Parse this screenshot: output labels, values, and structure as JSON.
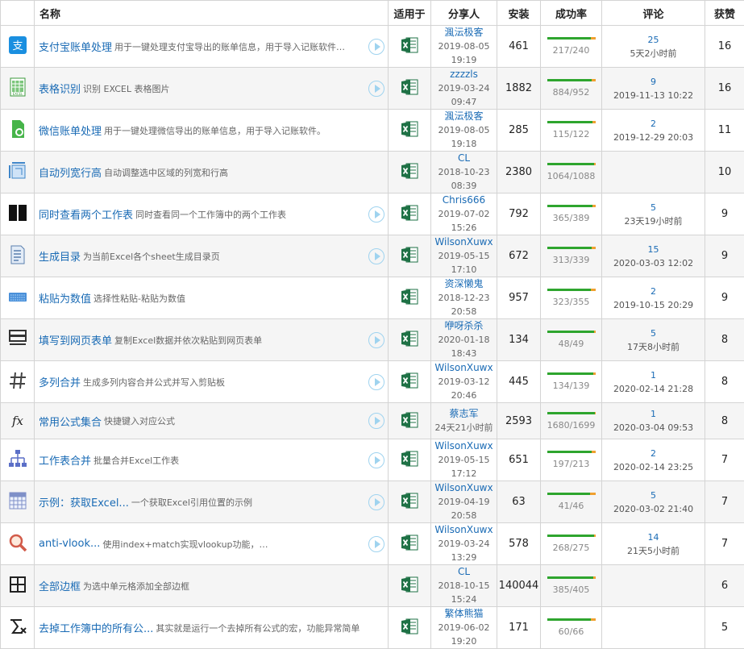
{
  "headers": {
    "icon": "",
    "name": "名称",
    "app": "适用于",
    "sharer": "分享人",
    "installs": "安装",
    "success_rate": "成功率",
    "comments": "评论",
    "likes": "获赞"
  },
  "colors": {
    "link": "#1a6bb5",
    "bar_success": "#2ea52e",
    "bar_fail": "#f0a030",
    "excel_green": "#1e7145"
  },
  "rows": [
    {
      "icon": "alipay-icon",
      "title": "支付宝账单处理",
      "desc": "用于一键处理支付宝导出的账单信息，用于导入记账软件…",
      "play": true,
      "app": "excel-icon",
      "sharer": "渢沄极客",
      "date": "2019-08-05 19:19",
      "installs": "461",
      "success": 217,
      "total": 240,
      "ratio": "217/240",
      "comment_count": "25",
      "comment_time": "5天2小时前",
      "likes": "16"
    },
    {
      "icon": "excel-sheet-icon",
      "title": "表格识别",
      "desc": "识别 EXCEL 表格图片",
      "play": true,
      "app": "excel-icon",
      "sharer": "zzzzls",
      "date": "2019-03-24 09:47",
      "installs": "1882",
      "success": 884,
      "total": 952,
      "ratio": "884/952",
      "comment_count": "9",
      "comment_time": "2019-11-13 10:22",
      "likes": "16"
    },
    {
      "icon": "wechat-bill-icon",
      "title": "微信账单处理",
      "desc": "用于一键处理微信导出的账单信息，用于导入记账软件。",
      "play": false,
      "app": "excel-icon",
      "sharer": "渢沄极客",
      "date": "2019-08-05 19:18",
      "installs": "285",
      "success": 115,
      "total": 122,
      "ratio": "115/122",
      "comment_count": "2",
      "comment_time": "2019-12-29 20:03",
      "likes": "11"
    },
    {
      "icon": "resize-icon",
      "title": "自动列宽行高",
      "desc": "自动调整选中区域的列宽和行高",
      "play": false,
      "app": "excel-icon",
      "sharer": "CL",
      "date": "2018-10-23 08:39",
      "installs": "2380",
      "success": 1064,
      "total": 1088,
      "ratio": "1064/1088",
      "comment_count": "",
      "comment_time": "",
      "likes": "10"
    },
    {
      "icon": "split-view-icon",
      "title": "同时查看两个工作表",
      "desc": "同时查看同一个工作簿中的两个工作表",
      "play": true,
      "app": "excel-icon",
      "sharer": "Chris666",
      "date": "2019-07-02 15:26",
      "installs": "792",
      "success": 365,
      "total": 389,
      "ratio": "365/389",
      "comment_count": "5",
      "comment_time": "23天19小时前",
      "likes": "9"
    },
    {
      "icon": "toc-document-icon",
      "title": "生成目录",
      "desc": "为当前Excel各个sheet生成目录页",
      "play": true,
      "app": "excel-icon",
      "sharer": "WilsonXuwx",
      "date": "2019-05-15 17:10",
      "installs": "672",
      "success": 313,
      "total": 339,
      "ratio": "313/339",
      "comment_count": "15",
      "comment_time": "2020-03-03 12:02",
      "likes": "9"
    },
    {
      "icon": "keyboard-icon",
      "title": "粘贴为数值",
      "desc": "选择性粘贴-粘贴为数值",
      "play": false,
      "app": "excel-icon",
      "sharer": "资深懒鬼",
      "date": "2018-12-23 20:58",
      "installs": "957",
      "success": 323,
      "total": 355,
      "ratio": "323/355",
      "comment_count": "2",
      "comment_time": "2019-10-15 20:29",
      "likes": "9"
    },
    {
      "icon": "web-form-icon",
      "title": "填写到网页表单",
      "desc": "复制Excel数据并依次粘贴到网页表单",
      "play": true,
      "app": "excel-icon",
      "sharer": "咿呀杀杀",
      "date": "2020-01-18 18:43",
      "installs": "134",
      "success": 48,
      "total": 49,
      "ratio": "48/49",
      "comment_count": "5",
      "comment_time": "17天8小时前",
      "likes": "8"
    },
    {
      "icon": "hash-icon",
      "title": "多列合并",
      "desc": "生成多列内容合并公式并写入剪贴板",
      "play": true,
      "app": "excel-icon",
      "sharer": "WilsonXuwx",
      "date": "2019-03-12 20:46",
      "installs": "445",
      "success": 134,
      "total": 139,
      "ratio": "134/139",
      "comment_count": "1",
      "comment_time": "2020-02-14 21:28",
      "likes": "8"
    },
    {
      "icon": "function-icon",
      "title": "常用公式集合",
      "desc": "快捷键入对应公式",
      "play": true,
      "app": "excel-icon",
      "sharer": "蔡志军",
      "date": "24天21小时前",
      "installs": "2593",
      "success": 1680,
      "total": 1699,
      "ratio": "1680/1699",
      "comment_count": "1",
      "comment_time": "2020-03-04 09:53",
      "likes": "8"
    },
    {
      "icon": "org-chart-icon",
      "title": "工作表合并",
      "desc": "批量合并Excel工作表",
      "play": true,
      "app": "excel-icon",
      "sharer": "WilsonXuwx",
      "date": "2019-05-15 17:12",
      "installs": "651",
      "success": 197,
      "total": 213,
      "ratio": "197/213",
      "comment_count": "2",
      "comment_time": "2020-02-14 23:25",
      "likes": "7"
    },
    {
      "icon": "grid-table-icon",
      "title": "示例：获取Excel...",
      "desc": "一个获取Excel引用位置的示例",
      "play": true,
      "app": "excel-icon",
      "sharer": "WilsonXuwx",
      "date": "2019-04-19 20:58",
      "installs": "63",
      "success": 41,
      "total": 46,
      "ratio": "41/46",
      "comment_count": "5",
      "comment_time": "2020-03-02 21:40",
      "likes": "7"
    },
    {
      "icon": "magnifier-icon",
      "title": "anti-vlook...",
      "desc": "使用index+match实现vlookup功能，…",
      "play": true,
      "app": "excel-icon",
      "sharer": "WilsonXuwx",
      "date": "2019-03-24 13:29",
      "installs": "578",
      "success": 268,
      "total": 275,
      "ratio": "268/275",
      "comment_count": "14",
      "comment_time": "21天5小时前",
      "likes": "7"
    },
    {
      "icon": "all-borders-icon",
      "title": "全部边框",
      "desc": "为选中单元格添加全部边框",
      "play": false,
      "app": "excel-icon",
      "sharer": "CL",
      "date": "2018-10-15 15:24",
      "installs": "140044",
      "success": 385,
      "total": 405,
      "ratio": "385/405",
      "comment_count": "",
      "comment_time": "",
      "likes": "6"
    },
    {
      "icon": "clear-formula-icon",
      "title": "去掉工作簿中的所有公...",
      "desc": "其实就是运行一个去掉所有公式的宏，功能异常简单",
      "play": false,
      "app": "excel-icon",
      "sharer": "繁体熊猫",
      "date": "2019-06-02 19:20",
      "installs": "171",
      "success": 60,
      "total": 66,
      "ratio": "60/66",
      "comment_count": "",
      "comment_time": "",
      "likes": "5"
    }
  ]
}
